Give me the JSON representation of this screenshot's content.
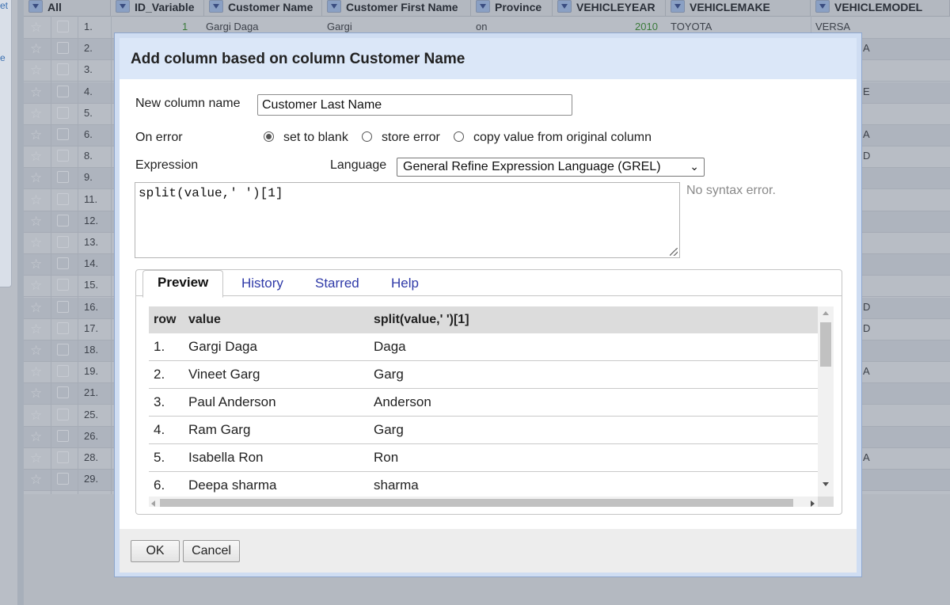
{
  "background_grid": {
    "left_panel_texts": [
      "et",
      "e"
    ],
    "all_label": "All",
    "columns": [
      "ID_Variable",
      "Customer Name",
      "Customer First Name",
      "Province",
      "VEHICLEYEAR",
      "VEHICLEMAKE",
      "VEHICLEMODEL"
    ],
    "row_numbers": [
      "1.",
      "2.",
      "3.",
      "4.",
      "5.",
      "6.",
      "8.",
      "9.",
      "11.",
      "12.",
      "13.",
      "14.",
      "15.",
      "16.",
      "17.",
      "18.",
      "19.",
      "21.",
      "25.",
      "26.",
      "28.",
      "29."
    ],
    "first_row": {
      "id": "1",
      "name": "Gargi Daga",
      "first_name": "Gargi",
      "province": "on",
      "year": "2010",
      "make": "TOYOTA",
      "model": "VERSA"
    },
    "model_fragments": [
      "A",
      "E",
      "A",
      "D",
      "D",
      "D",
      "A",
      "A"
    ]
  },
  "dialog": {
    "title": "Add column based on column Customer Name",
    "new_column_label": "New column name",
    "new_column_value": "Customer Last Name",
    "on_error_label": "On error",
    "on_error_options": [
      "set to blank",
      "store error",
      "copy value from original column"
    ],
    "on_error_selected": "set to blank",
    "expression_label": "Expression",
    "language_label": "Language",
    "language_value": "General Refine Expression Language (GREL)",
    "expression_value": "split(value,' ')[1]",
    "syntax_status": "No syntax error.",
    "tabs": [
      "Preview",
      "History",
      "Starred",
      "Help"
    ],
    "active_tab": "Preview",
    "preview": {
      "headers": [
        "row",
        "value",
        "split(value,' ')[1]"
      ],
      "rows": [
        [
          "1.",
          "Gargi Daga",
          "Daga"
        ],
        [
          "2.",
          "Vineet Garg",
          "Garg"
        ],
        [
          "3.",
          "Paul Anderson",
          "Anderson"
        ],
        [
          "4.",
          "Ram Garg",
          "Garg"
        ],
        [
          "5.",
          "Isabella Ron",
          "Ron"
        ],
        [
          "6.",
          "Deepa sharma",
          "sharma"
        ]
      ]
    },
    "ok_label": "OK",
    "cancel_label": "Cancel"
  }
}
